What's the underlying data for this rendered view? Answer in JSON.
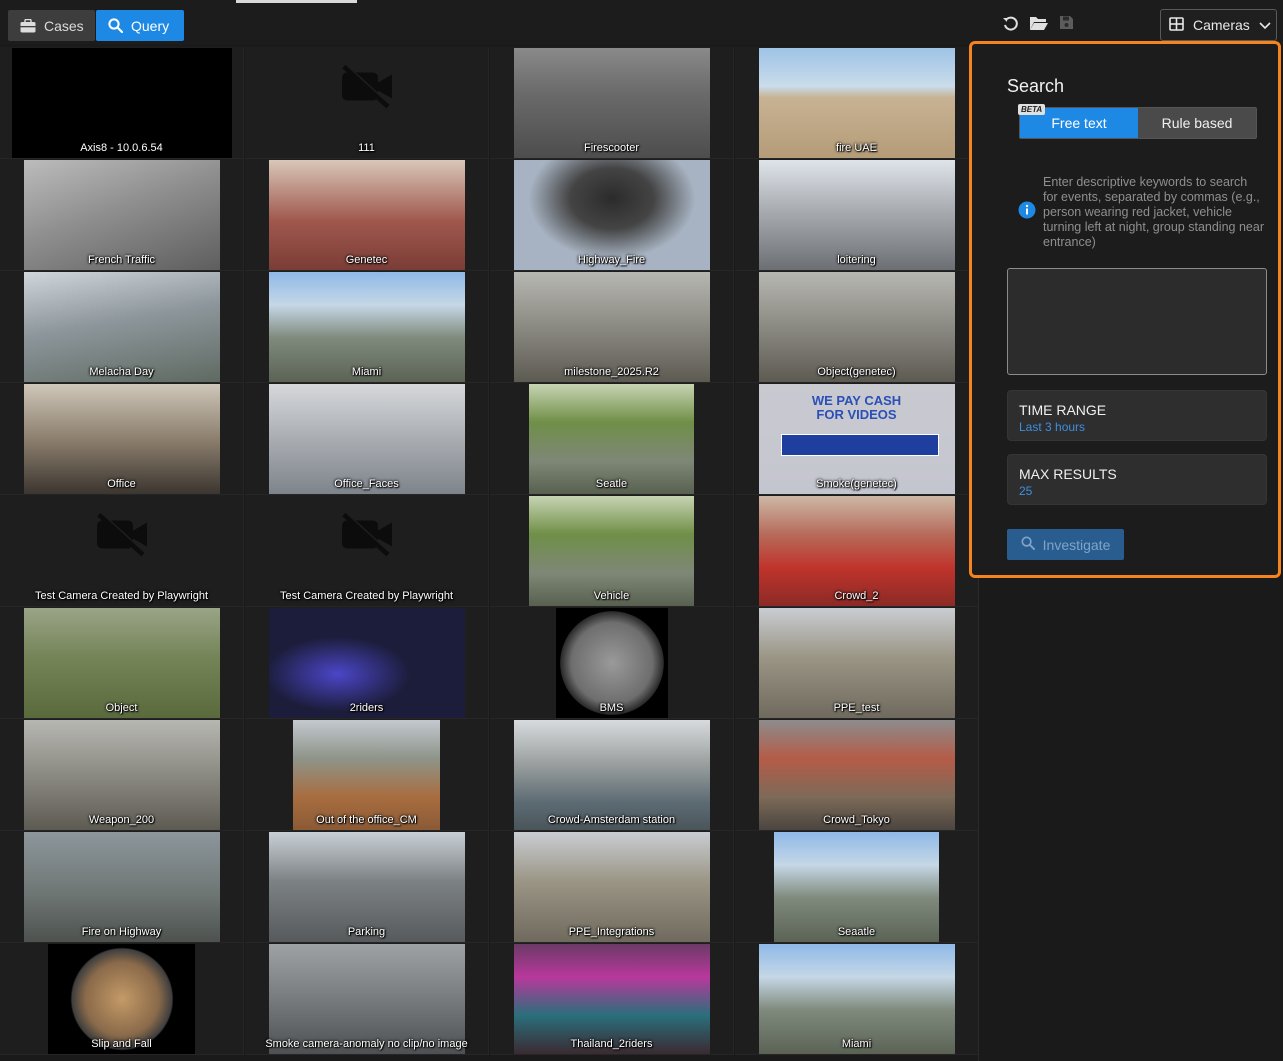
{
  "toolbar": {
    "cases_label": "Cases",
    "query_label": "Query",
    "cameras_label": "Cameras",
    "icons": [
      "briefcase-icon",
      "search-icon",
      "undo-icon",
      "folder-open-icon",
      "save-icon",
      "grid-icon",
      "chevron-down-icon"
    ],
    "active_tab_color": "#1e88e5"
  },
  "search_panel": {
    "title": "Search",
    "mode_free_text": "Free text",
    "mode_rule_based": "Rule based",
    "beta_badge": "BETA",
    "info_text": "Enter descriptive keywords to search for events, separated by commas (e.g., person wearing red jacket, vehicle turning left at night, group standing near entrance)",
    "query_value": "",
    "time_range_label": "TIME RANGE",
    "time_range_value": "Last 3 hours",
    "max_results_label": "MAX RESULTS",
    "max_results_value": "25",
    "investigate_label": "Investigate",
    "highlight_color": "#f5841f"
  },
  "cameras": [
    {
      "name": "Axis8 - 10.0.6.54",
      "thumb": "black"
    },
    {
      "name": "111",
      "thumb": "none"
    },
    {
      "name": "Firescooter",
      "thumb": "street"
    },
    {
      "name": "fire UAE",
      "thumb": "desert"
    },
    {
      "name": "French Traffic",
      "thumb": "highway"
    },
    {
      "name": "Genetec",
      "thumb": "indoor-red"
    },
    {
      "name": "Highway_Fire",
      "thumb": "smoke"
    },
    {
      "name": "loitering",
      "thumb": "station"
    },
    {
      "name": "Melacha Day",
      "thumb": "city"
    },
    {
      "name": "Miami",
      "thumb": "street-sunny"
    },
    {
      "name": "milestone_2025.R2",
      "thumb": "office"
    },
    {
      "name": "Object(genetec)",
      "thumb": "office"
    },
    {
      "name": "Office",
      "thumb": "kitchen"
    },
    {
      "name": "Office_Faces",
      "thumb": "hall"
    },
    {
      "name": "Seatle",
      "thumb": "trees"
    },
    {
      "name": "Smoke(genetec)",
      "thumb": "ad"
    },
    {
      "name": "Test Camera Created by Playwright",
      "thumb": "none"
    },
    {
      "name": "Test Camera Created by Playwright",
      "thumb": "none"
    },
    {
      "name": "Vehicle",
      "thumb": "trees"
    },
    {
      "name": "Crowd_2",
      "thumb": "crowd"
    },
    {
      "name": "Object",
      "thumb": "garden"
    },
    {
      "name": "2riders",
      "thumb": "night"
    },
    {
      "name": "BMS",
      "thumb": "fisheye"
    },
    {
      "name": "PPE_test",
      "thumb": "construction"
    },
    {
      "name": "Weapon_200",
      "thumb": "office"
    },
    {
      "name": "Out of the office_CM",
      "thumb": "aerial"
    },
    {
      "name": "Crowd-Amsterdam station",
      "thumb": "harbor"
    },
    {
      "name": "Crowd_Tokyo",
      "thumb": "tokyo"
    },
    {
      "name": "Fire on Highway",
      "thumb": "gray-highway"
    },
    {
      "name": "Parking",
      "thumb": "parking"
    },
    {
      "name": "PPE_Integrations",
      "thumb": "construction"
    },
    {
      "name": "Seaatle",
      "thumb": "street-sunny"
    },
    {
      "name": "Slip and Fall",
      "thumb": "fisheye-warm"
    },
    {
      "name": "Smoke camera-anomaly no clip/no image",
      "thumb": "gray-room"
    },
    {
      "name": "Thailand_2riders",
      "thumb": "neon"
    },
    {
      "name": "Miami",
      "thumb": "street-sunny"
    }
  ]
}
